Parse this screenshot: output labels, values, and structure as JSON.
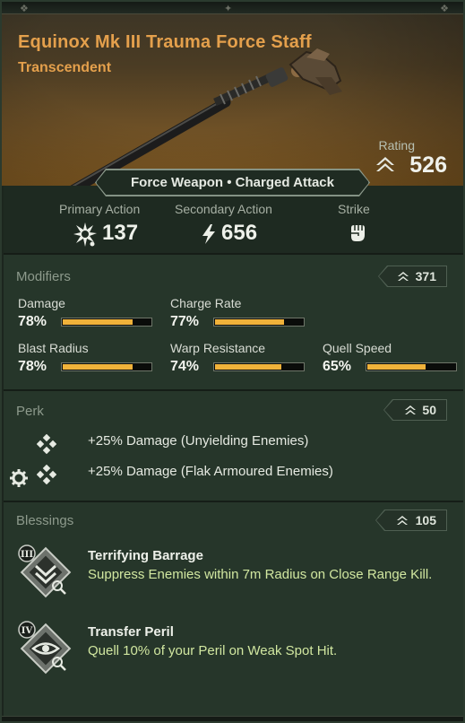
{
  "weapon": {
    "name": "Equinox Mk III Trauma Force Staff",
    "rarity": "Transcendent",
    "rating_label": "Rating",
    "rating_value": "526",
    "keywords": "Force Weapon • Charged Attack"
  },
  "actions": [
    {
      "label": "Primary Action",
      "value": "137",
      "icon": "explosion-icon"
    },
    {
      "label": "Secondary Action",
      "value": "656",
      "icon": "lightning-icon"
    },
    {
      "label": "Strike",
      "value": "",
      "icon": "fist-icon"
    }
  ],
  "modifiers": {
    "title": "Modifiers",
    "score": "371",
    "items": [
      {
        "name": "Damage",
        "pct": "78%",
        "fraction": 0.78
      },
      {
        "name": "Charge Rate",
        "pct": "77%",
        "fraction": 0.77
      },
      {
        "name": "Blast Radius",
        "pct": "78%",
        "fraction": 0.78
      },
      {
        "name": "Warp Resistance",
        "pct": "74%",
        "fraction": 0.74
      },
      {
        "name": "Quell Speed",
        "pct": "65%",
        "fraction": 0.65
      }
    ]
  },
  "perk": {
    "title": "Perk",
    "score": "50",
    "items": [
      "+25% Damage (Unyielding Enemies)",
      "+25% Damage (Flak Armoured Enemies)"
    ]
  },
  "blessings": {
    "title": "Blessings",
    "score": "105",
    "items": [
      {
        "tier": "III",
        "name": "Terrifying Barrage",
        "desc": "Suppress Enemies within 7m Radius on Close Range Kill."
      },
      {
        "tier": "IV",
        "name": "Transfer Peril",
        "desc": "Quell 10% of your Peril on Weak Spot Hit."
      }
    ]
  },
  "colors": {
    "title_orange": "#e4a04c",
    "bar_fill": "#f0b23a",
    "blessing_desc": "#d1e7a0"
  }
}
